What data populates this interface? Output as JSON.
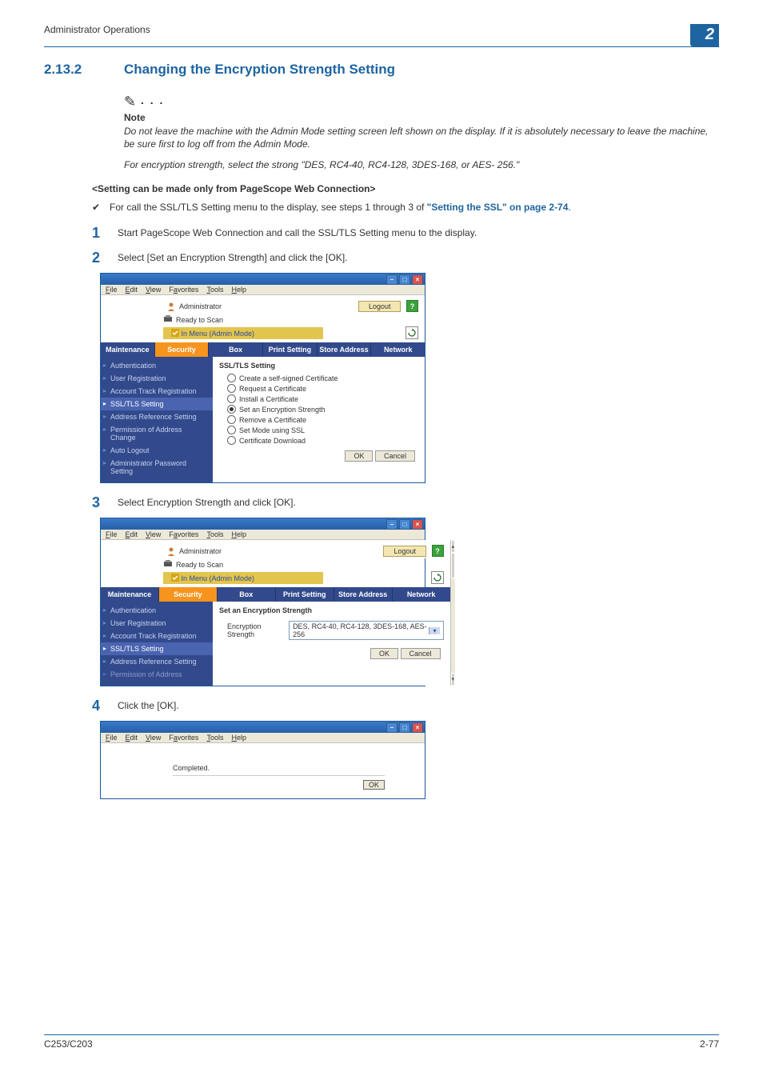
{
  "header": {
    "title": "Administrator Operations"
  },
  "chapter": "2",
  "section": {
    "number": "2.13.2",
    "title": "Changing the Encryption Strength Setting"
  },
  "note": {
    "label": "Note",
    "p1": "Do not leave the machine with the Admin Mode setting screen left shown on the display. If it is absolutely necessary to leave the machine, be sure first to log off from the Admin Mode.",
    "p2": "For encryption strength, select the strong \"DES, RC4-40, RC4-128, 3DES-168, or AES- 256.\""
  },
  "subhead": "<Setting can be made only from PageScope Web Connection>",
  "prereq": {
    "text": "For call the SSL/TLS Setting menu to the display, see steps 1 through 3 of ",
    "link": "\"Setting the SSL\" on page 2-74",
    "tail": "."
  },
  "steps": {
    "s1": "Start PageScope Web Connection and call the SSL/TLS Setting menu to the display.",
    "s2": "Select [Set an Encryption Strength] and click the [OK].",
    "s3": "Select Encryption Strength and click [OK].",
    "s4": "Click the [OK]."
  },
  "browser": {
    "menu": {
      "file": "File",
      "edit": "Edit",
      "view": "View",
      "favorites": "Favorites",
      "tools": "Tools",
      "help": "Help"
    },
    "admin_label": "Administrator",
    "logout": "Logout",
    "help": "?",
    "status1": "Ready to Scan",
    "status2": "In Menu (Admin Mode)",
    "tabs": {
      "maintenance": "Maintenance",
      "security": "Security",
      "box": "Box",
      "print": "Print Setting",
      "store": "Store Address",
      "network": "Network"
    },
    "sidebar": {
      "auth": "Authentication",
      "user_reg": "User Registration",
      "acct": "Account Track Registration",
      "ssl": "SSL/TLS Setting",
      "addr_ref": "Address Reference Setting",
      "perm": "Permission of Address Change",
      "autologout": "Auto Logout",
      "adminpw": "Administrator Password Setting",
      "perm2": "Permission of Address"
    }
  },
  "win1": {
    "title": "SSL/TLS Setting",
    "opts": {
      "create": "Create a self-signed Certificate",
      "request": "Request a Certificate",
      "install": "Install a Certificate",
      "set": "Set an Encryption Strength",
      "remove": "Remove a Certificate",
      "mode": "Set Mode using SSL",
      "download": "Certificate Download"
    },
    "ok": "OK",
    "cancel": "Cancel"
  },
  "win2": {
    "title": "Set an Encryption Strength",
    "label": "Encryption Strength",
    "value": "DES, RC4-40, RC4-128, 3DES-168, AES-256",
    "ok": "OK",
    "cancel": "Cancel"
  },
  "win3": {
    "msg": "Completed.",
    "ok": "OK"
  },
  "footer": {
    "left": "C253/C203",
    "right": "2-77"
  }
}
